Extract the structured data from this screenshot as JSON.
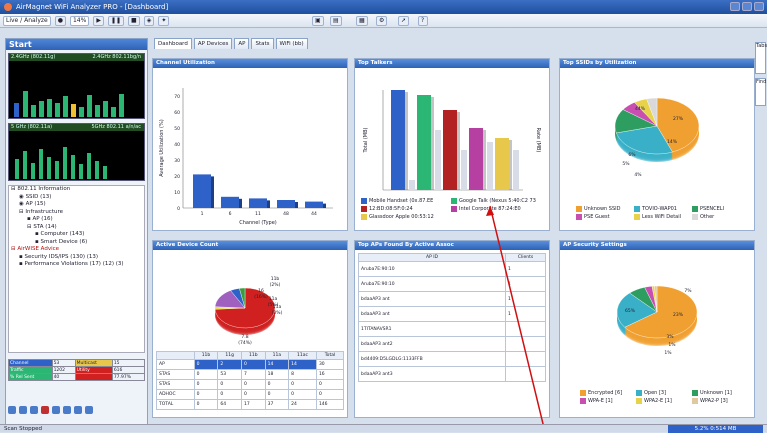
{
  "window": {
    "title": "AirMagnet WiFi Analyzer PRO - [Dashboard]"
  },
  "toolbar": {
    "items": [
      "Live / Analyze",
      "14%"
    ]
  },
  "left": {
    "start_label": "Start",
    "mini_charts": [
      {
        "left": "2.4GHz (802.11g)",
        "right": "2.4GHz 802.11bg/n"
      },
      {
        "left": "5 GHz (802.11a)",
        "right": "5GHz 802.11 a/n/ac"
      }
    ],
    "tree": [
      "802.11 Information",
      "SSID (13)",
      "AP (15)",
      "Infrastructure",
      "AP (16)",
      "STA (14)",
      "Computer (143)",
      "Smart Device (6)",
      "AirWISE Advice",
      "Security IDS/IPS (130) (13)",
      "Performance Violations (17) (12) (3)"
    ],
    "table": [
      [
        "Channel",
        "53",
        "Multicast",
        "15"
      ],
      [
        "Traffic",
        "1202",
        "Utility",
        "616"
      ],
      [
        "% Rel Sent",
        "40",
        "",
        "77.97%"
      ]
    ]
  },
  "tabs": [
    "Dashboard",
    "AP Devices",
    "AP",
    "Stats",
    "WiFi (bb)"
  ],
  "right_tabs": [
    "Tabs",
    "Find"
  ],
  "panels": {
    "channel": {
      "title": "Channel Utilization",
      "xlabel": "Channel (Type)",
      "ylabel": "Average Utilization (%)"
    },
    "talkers": {
      "title": "Top Talkers",
      "ylabel": "Total (MB)",
      "y2label": "Rate (MB)"
    },
    "ssids": {
      "title": "Top SSIDs by Utilization"
    },
    "devices": {
      "title": "Active Device Count"
    },
    "aps": {
      "title": "Top APs Found By Active Assoc",
      "col1": "AP ID",
      "col2": "Clients"
    },
    "security": {
      "title": "AP Security Settings"
    }
  },
  "chart_data": [
    {
      "type": "bar",
      "title": "Channel Utilization",
      "categories": [
        "1",
        "6",
        "11",
        "48",
        "44"
      ],
      "values": [
        21,
        7,
        6,
        5,
        4
      ],
      "ylim": [
        0,
        75
      ],
      "yticks": [
        "0",
        "10",
        "20",
        "30",
        "40",
        "50",
        "60",
        "70"
      ],
      "xlabel": "Channel (Type)",
      "ylabel": "Average Utilization (%)",
      "colors": [
        "#2e62c8"
      ]
    },
    {
      "type": "bar",
      "title": "Top Talkers",
      "series": [
        {
          "name": "Mobile Handset (0x.87.EE",
          "values": [
            100
          ],
          "color": "#2e62c8"
        },
        {
          "name": "Google Talk (Nexus 5:40:C2 73",
          "values": [
            95
          ],
          "color": "#2bb673"
        },
        {
          "name": "12:BD:08:5F:0:24",
          "values": [
            80
          ],
          "color": "#b22222"
        },
        {
          "name": "Intel Corporate 87:24:E0",
          "values": [
            62
          ],
          "color": "#b63fa2"
        },
        {
          "name": "Glassdoor Apple 00:53:12",
          "values": [
            52
          ],
          "color": "#e8c84a"
        }
      ],
      "ylabel": "Total (MB)"
    },
    {
      "type": "pie",
      "title": "Top SSIDs by Utilization",
      "slices": [
        {
          "name": "Unknown SSID",
          "value": 44,
          "color": "#f0a030"
        },
        {
          "name": "TOVIO-WAP01",
          "value": 27,
          "color": "#3ab0c8"
        },
        {
          "name": "PSENCELI",
          "value": 14,
          "color": "#2e9e60"
        },
        {
          "name": "PSE Guest",
          "value": 6,
          "color": "#c84fb0"
        },
        {
          "name": "Less WiFi Detail",
          "value": 5,
          "color": "#e8d24a"
        },
        {
          "name": "Other",
          "value": 4,
          "color": "#d9d9d9"
        }
      ]
    },
    {
      "type": "pie",
      "title": "Active Device Count",
      "slices": [
        {
          "name": "11b",
          "value": 74,
          "color": "#d02020",
          "label": "7.8\n(74%)"
        },
        {
          "name": "11g",
          "value": 2,
          "color": "#e0e040",
          "label": "11b\n(2%)"
        },
        {
          "name": "11n",
          "value": 16,
          "color": "#a060c0",
          "label": "16\n(16%)"
        },
        {
          "name": "11a",
          "value": 5,
          "color": "#2e62c8",
          "label": "11a\n(5%)"
        },
        {
          "name": "11ac",
          "value": 3,
          "color": "#3c9b3c",
          "label": "11a\n(3%)"
        }
      ]
    },
    {
      "type": "pie",
      "title": "AP Security Settings",
      "slices": [
        {
          "name": "Encrypted [6]",
          "value": 65,
          "color": "#f0a030",
          "label": "65%"
        },
        {
          "name": "Open [3]",
          "value": 23,
          "color": "#3ab0c8",
          "label": "23%"
        },
        {
          "name": "Unknown [1]",
          "value": 7,
          "color": "#2e9e60",
          "label": "7%"
        },
        {
          "name": "WPA-E [1]",
          "value": 3,
          "color": "#c84fb0",
          "label": "3%"
        },
        {
          "name": "WPA2-E [1]",
          "value": 1,
          "color": "#e8d24a",
          "label": "1%"
        },
        {
          "name": "WPA2-P [3]",
          "value": 1,
          "color": "#e0c8a0",
          "label": "1%"
        }
      ]
    }
  ],
  "device_table": {
    "headers": [
      "",
      "11b",
      "11g",
      "11b",
      "11a",
      "11ac",
      "Total"
    ],
    "rows": [
      {
        "label": "AP",
        "vals": [
          "0",
          "2",
          "0",
          "14",
          "14",
          "30"
        ]
      },
      {
        "label": "STAS",
        "vals": [
          "0",
          "53",
          "7",
          "18",
          "8",
          "16"
        ]
      },
      {
        "label": "STAS",
        "vals": [
          "0",
          "0",
          "0",
          "0",
          "0",
          "0"
        ]
      },
      {
        "label": "ADHOC",
        "vals": [
          "0",
          "0",
          "0",
          "0",
          "0",
          "0"
        ]
      },
      {
        "label": "TOTAL",
        "vals": [
          "0",
          "64",
          "17",
          "37",
          "24",
          "146"
        ]
      }
    ]
  },
  "ap_table": {
    "rows": [
      {
        "id": "Aruba7E:90:10",
        "count": "1"
      },
      {
        "id": "Aruba7E:90:10",
        "count": "1"
      },
      {
        "id": "bdaaAP3 ant",
        "count": "1"
      },
      {
        "id": "bdaaAP3 ant",
        "count": "1"
      },
      {
        "id": "1TITANAVSR1",
        "count": ""
      },
      {
        "id": "bdaaAP3 ant2",
        "count": ""
      },
      {
        "id": "bd4409:D5LGDLG:1133FFB",
        "count": ""
      },
      {
        "id": "bdaaAP3 ant3",
        "count": ""
      }
    ]
  },
  "status": {
    "text": "Scan Stopped",
    "right": "5.2% 0:514 MB"
  }
}
